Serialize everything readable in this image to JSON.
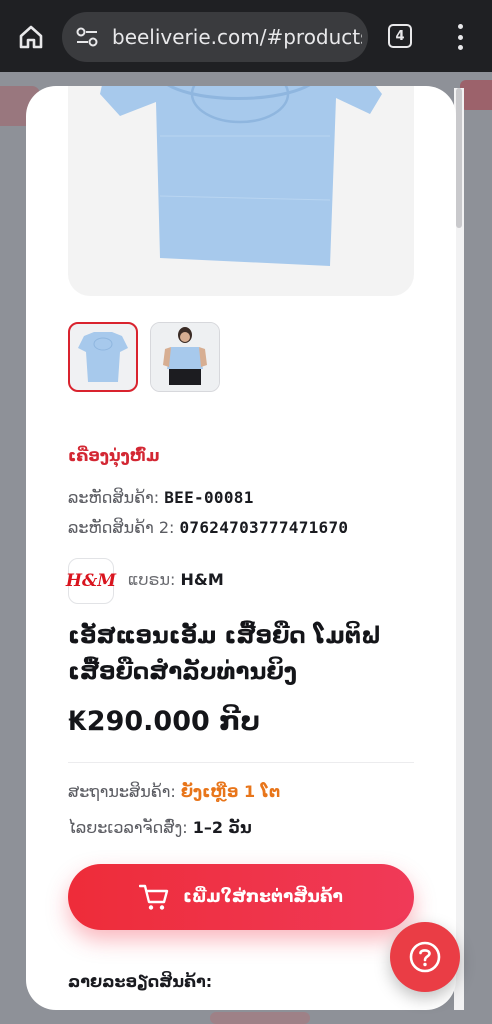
{
  "browser": {
    "url": "beeliverie.com/#products-s",
    "tab_count": "4"
  },
  "product": {
    "category": "ເຄື່ອງນຸ່ງຫົ່ມ",
    "code_label": "ລະຫັດສິນຄ້າ:",
    "code_value": "BEE-00081",
    "code2_label": "ລະຫັດສິນຄ້າ 2:",
    "code2_value": "07624703777471670",
    "brand_logo_text": "H&M",
    "brand_label": "ແບຣນ:",
    "brand_value": "H&M",
    "title": "ເອັສແອນເອັມ ເສື້ອຍືດ ໂມຕິຟ ເສື້ອຍືດສຳລັບທ່ານຍິງ",
    "price": "₭290.000 ກີບ",
    "stock_label": "ສະຖານະສິນຄ້າ:",
    "stock_value": "ຍັງເຫຼືອ 1 ໂຕ",
    "delivery_label": "ໄລຍະເວລາຈັດສົ່ງ:",
    "delivery_value": "1–2 ວັນ",
    "add_to_cart_label": "ເພີ່ມໃສ່ກະຕ່າສິນຄ້າ",
    "description_heading": "ລາຍລະອຽດສິນຄ້າ:"
  },
  "colors": {
    "accent": "#ee2c39",
    "stock": "#e8751a",
    "topbar": "#1f2023"
  }
}
